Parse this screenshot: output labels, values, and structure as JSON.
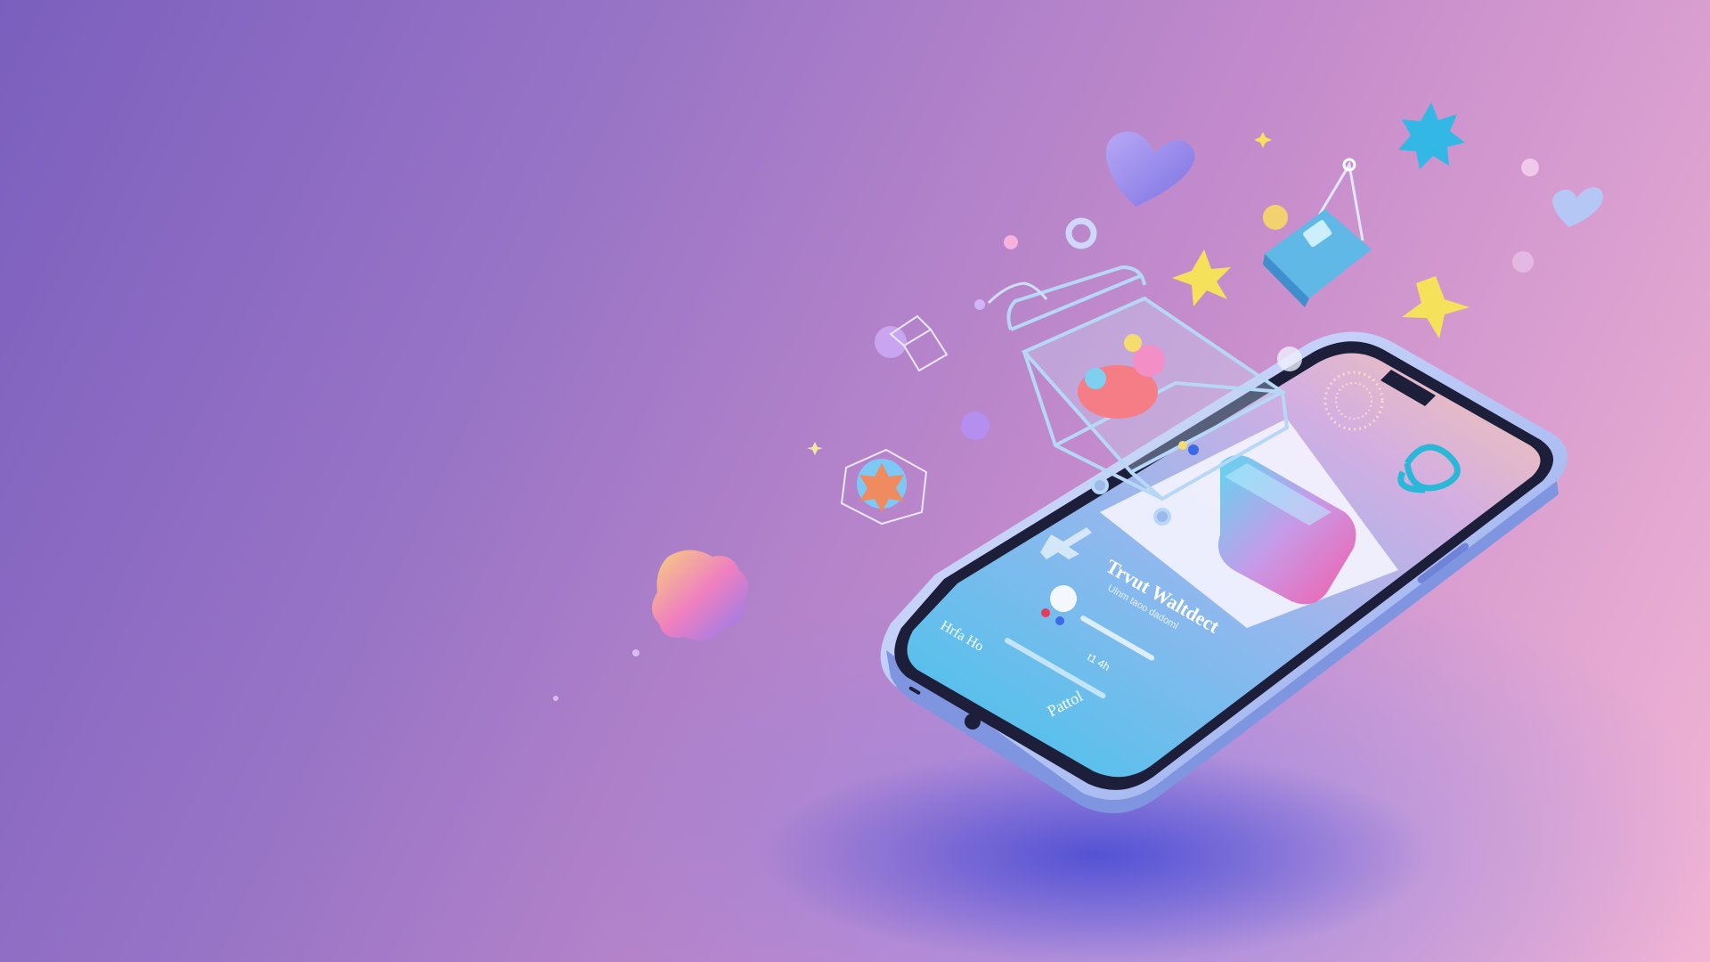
{
  "image": {
    "subject": "isometric-phone-shopping-illustration",
    "palette": {
      "bg_left": "#7b5fbe",
      "bg_mid": "#c58ccc",
      "bg_right": "#f2b4d4",
      "phone_frame": "#b9c8f4",
      "screen_top": "#f4c4b0",
      "screen_bottom": "#56c6e6",
      "accent_cyan": "#39c1e8",
      "accent_yellow": "#f5e25a",
      "accent_pink": "#f06fb2"
    },
    "screen_text": {
      "title": "Trvut Waltdect",
      "subtitle": "Ulnm taoo dadoml",
      "left_label": "Hrfa Ho",
      "bottom_label": "Pattol",
      "price": "t1 4h"
    },
    "icons": [
      "shopping-cart-icon",
      "heart-icon",
      "star-icon",
      "shopping-bag-icon",
      "gift-box-icon",
      "gem-icon"
    ]
  }
}
